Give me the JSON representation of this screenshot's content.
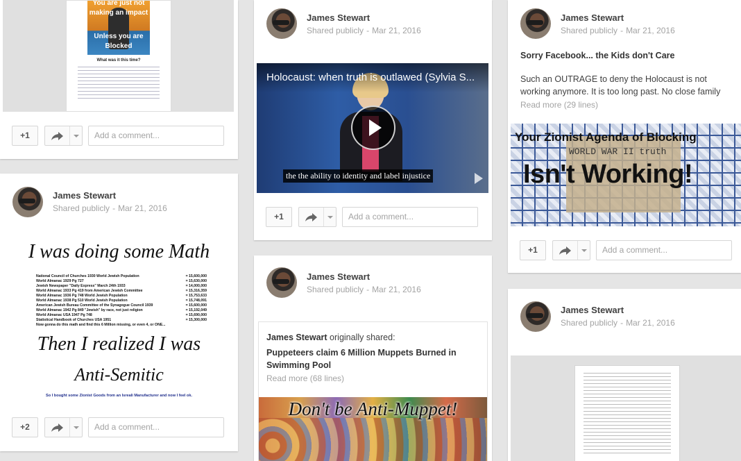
{
  "author": "James Stewart",
  "visibility": "Shared publicly",
  "date": "Mar 21, 2016",
  "comment_placeholder": "Add a comment...",
  "posts": {
    "p1": {
      "plus": "+1",
      "poster_top": "You are just not",
      "poster_line2": "making an impact",
      "poster_line3": "Unless you are",
      "poster_line4": "Blocked",
      "poster_sub": "What was it this time?"
    },
    "p2": {
      "plus": "+2",
      "math_title": "I was doing some Math",
      "math_rows": [
        {
          "label": "National Council of Churches 1930 World Jewish Population",
          "value": "= 15,600,000"
        },
        {
          "label": "World Almanac 1929 Pg 727",
          "value": "= 15,630,000"
        },
        {
          "label": "Jewish Newspaper \"Daily Express\" March 24th 1933",
          "value": "= 14,000,000"
        },
        {
          "label": "World Almanac 1933 Pg 419 from American Jewish Committee",
          "value": "= 15,316,359"
        },
        {
          "label": "World Almanac 1936 Pg 748 World Jewish Population",
          "value": "= 15,753,633"
        },
        {
          "label": "World Almanac 1938 Pg 510 World Jewish Population",
          "value": "= 15,748,091"
        },
        {
          "label": "American Jewish Bureau Committee of the Synagogue Council 1939",
          "value": "= 15,600,000"
        },
        {
          "label": "World Almanac 1942 Pg 849 \"Jewish\" by race, not just religion",
          "value": "= 15,192,049"
        },
        {
          "label": "World Almanac USA 1947 Pg 748",
          "value": "= 15,690,000"
        },
        {
          "label": "Statistical Handbook of Churches USA 1951",
          "value": "= 15,300,000"
        },
        {
          "label": "Now gonna do this math and find this 6 Million missing, or even 4, or ONE...",
          "value": ""
        }
      ],
      "realized_1": "Then I realized I was",
      "realized_2": "Anti-Semitic",
      "footer": "So I bought some Zionist Goods from an Isreali Manufacturer and now I feel ok."
    },
    "p3": {
      "plus": "+1",
      "video_title": "Holocaust: when truth is outlawed (Sylvia S...",
      "video_caption": "the the ability to identity and label injustice"
    },
    "p4": {
      "shared_author": "James Stewart",
      "shared_suffix": "originally shared:",
      "headline": "Puppeteers claim 6 Million Muppets Burned in Swimming Pool",
      "read_more": "Read more (68 lines)",
      "image_text": "Don't be Anti-Muppet!"
    },
    "p5": {
      "plus": "+1",
      "title": "Sorry Facebook... the Kids don't Care",
      "body": "Such an OUTRAGE to deny the Holocaust is not working anymore. It is too long past. No close family",
      "read_more": "Read more (29 lines)",
      "img_line1": "Your Zionist Agenda of Blocking",
      "img_line2": "WORLD WAR II truth",
      "img_line3": "Isn't Working!"
    }
  },
  "colors": {
    "background": "#e5e5e5",
    "card": "#ffffff",
    "muted": "#a3a3a3",
    "play": "#000000"
  }
}
